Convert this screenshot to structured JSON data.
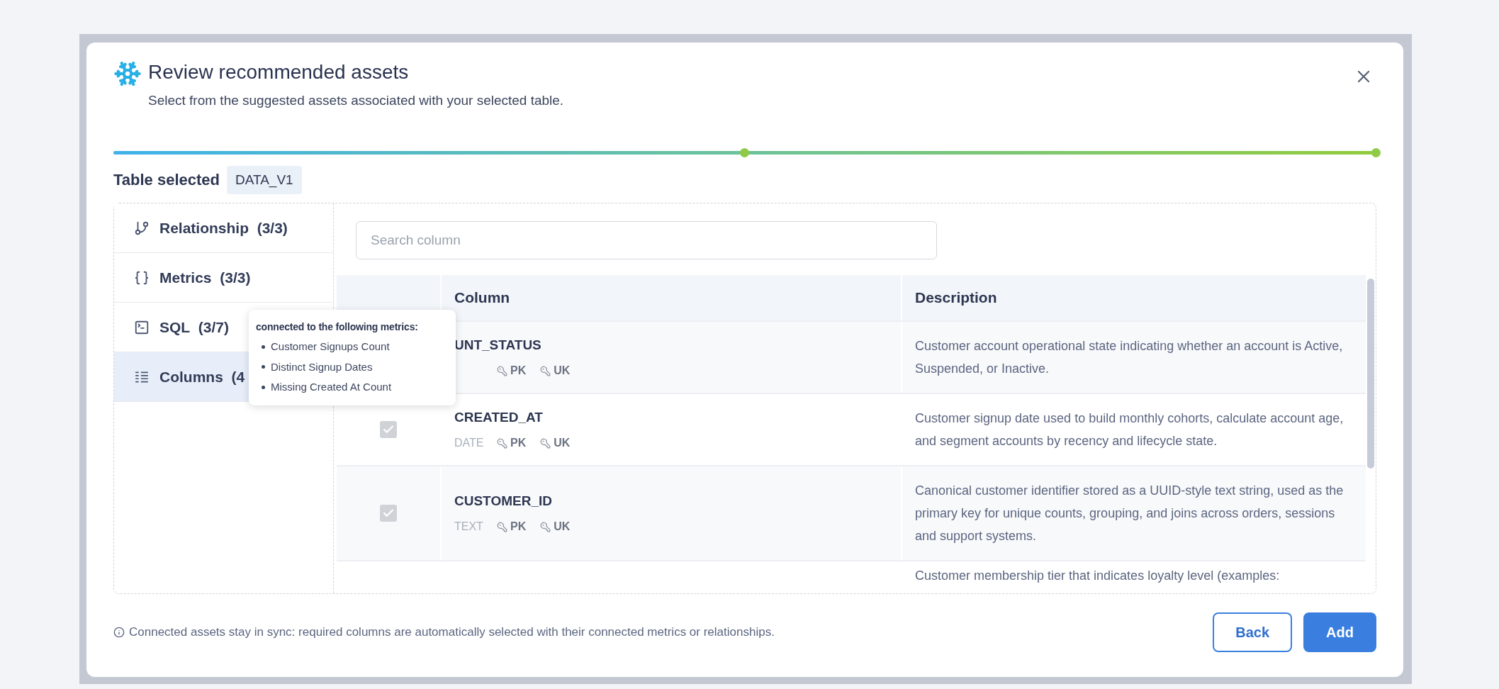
{
  "dialog": {
    "title": "Review recommended assets",
    "subtitle": "Select from the suggested assets associated with your selected table."
  },
  "progress": {
    "level": 1,
    "steps": [
      {
        "completed": true
      },
      {
        "completed": true
      }
    ]
  },
  "table_selected": {
    "label": "Table selected",
    "value": "DATA_V1"
  },
  "sidebar": {
    "items": [
      {
        "kind": "relationship",
        "label": "Relationship",
        "count": "(3/3)",
        "selected": false
      },
      {
        "kind": "metrics",
        "label": "Metrics",
        "count": "(3/3)",
        "selected": false
      },
      {
        "kind": "sql",
        "label": "SQL",
        "count": "(3/7)",
        "selected": false
      },
      {
        "kind": "columns",
        "label": "Columns",
        "count": "(4",
        "selected": true
      }
    ]
  },
  "search": {
    "placeholder": "Search column"
  },
  "table": {
    "columns": [
      "Column",
      "Description"
    ],
    "rows": [
      {
        "name": "UNT_STATUS",
        "keys": [
          "PK",
          "UK"
        ],
        "description": "Customer account operational state indicating whether an account is Active, Suspended, or Inactive."
      },
      {
        "name": "CREATED_AT",
        "type": "DATE",
        "keys": [
          "PK",
          "UK"
        ],
        "checked": true,
        "description": "Customer signup date used to build monthly cohorts, calculate account age, and segment accounts by recency and lifecycle state."
      },
      {
        "name": "CUSTOMER_ID",
        "type": "TEXT",
        "keys": [
          "PK",
          "UK"
        ],
        "checked": true,
        "description": "Canonical customer identifier stored as a UUID-style text string, used as the primary key for unique counts, grouping, and joins across orders, sessions and support systems."
      },
      {
        "description": "Customer membership tier that indicates loyalty level (examples:"
      }
    ]
  },
  "tooltip": {
    "title": "connected to the following metrics:",
    "items": [
      "Customer Signups Count",
      "Distinct Signup Dates",
      "Missing Created At Count"
    ]
  },
  "footer": {
    "note": "Connected assets stay in sync: required columns are automatically selected with their connected metrics or relationships.",
    "buttons": [
      {
        "kind": "secondary",
        "label": "Back"
      },
      {
        "kind": "primary",
        "label": "Add"
      }
    ]
  }
}
